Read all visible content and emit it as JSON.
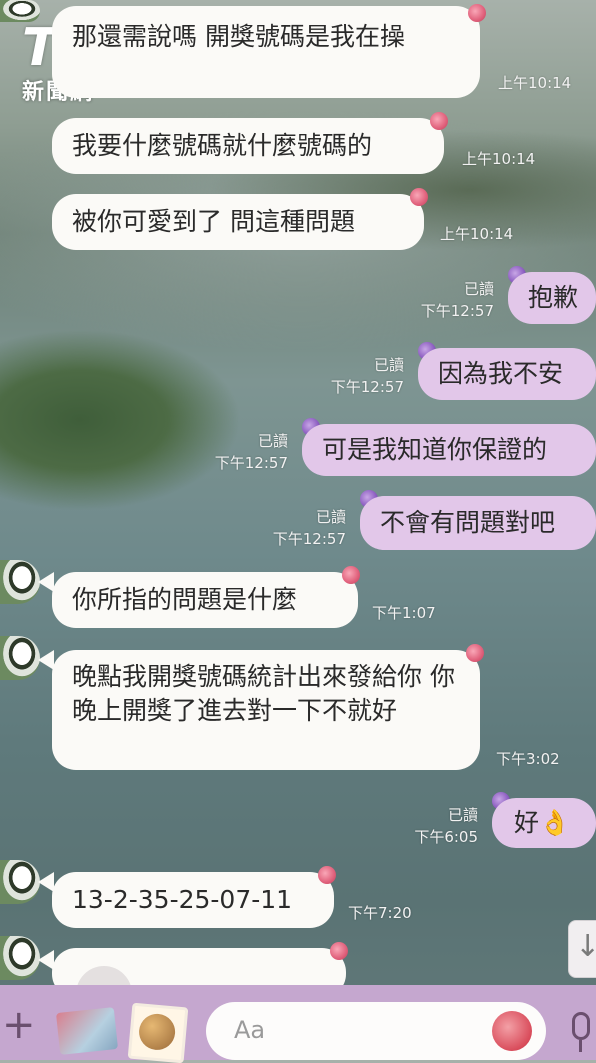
{
  "watermark": {
    "logo": "TVBS",
    "sub": "新聞網"
  },
  "messages": [
    {
      "side": "left",
      "text": "那還需說嗎 開獎號碼是我在操",
      "time": "上午10:14"
    },
    {
      "side": "left",
      "text": "我要什麼號碼就什麼號碼的",
      "time": "上午10:14"
    },
    {
      "side": "left",
      "text": "被你可愛到了 問這種問題",
      "time": "上午10:14"
    },
    {
      "side": "right",
      "text": "抱歉",
      "read": "已讀",
      "time": "下午12:57"
    },
    {
      "side": "right",
      "text": "因為我不安",
      "read": "已讀",
      "time": "下午12:57"
    },
    {
      "side": "right",
      "text": "可是我知道你保證的",
      "read": "已讀",
      "time": "下午12:57"
    },
    {
      "side": "right",
      "text": "不會有問題對吧",
      "read": "已讀",
      "time": "下午12:57"
    },
    {
      "side": "left",
      "text": "你所指的問題是什麼",
      "time": "下午1:07"
    },
    {
      "side": "left",
      "text": "晚點我開獎號碼統計出來發給你 你晚上開獎了進去對一下不就好",
      "time": "下午3:02"
    },
    {
      "side": "right",
      "text": "好👌",
      "read": "已讀",
      "time": "下午6:05"
    },
    {
      "side": "left",
      "text": "13-2-35-25-07-11",
      "time": "下午7:20"
    }
  ],
  "input": {
    "placeholder": "Aa"
  },
  "icons": {
    "plus": "+",
    "scroll_down": "↓"
  },
  "colors": {
    "left_bubble": "#fbfaf7",
    "right_bubble": "#e2c7e9",
    "bottom_bar": "#c5a7cf"
  }
}
